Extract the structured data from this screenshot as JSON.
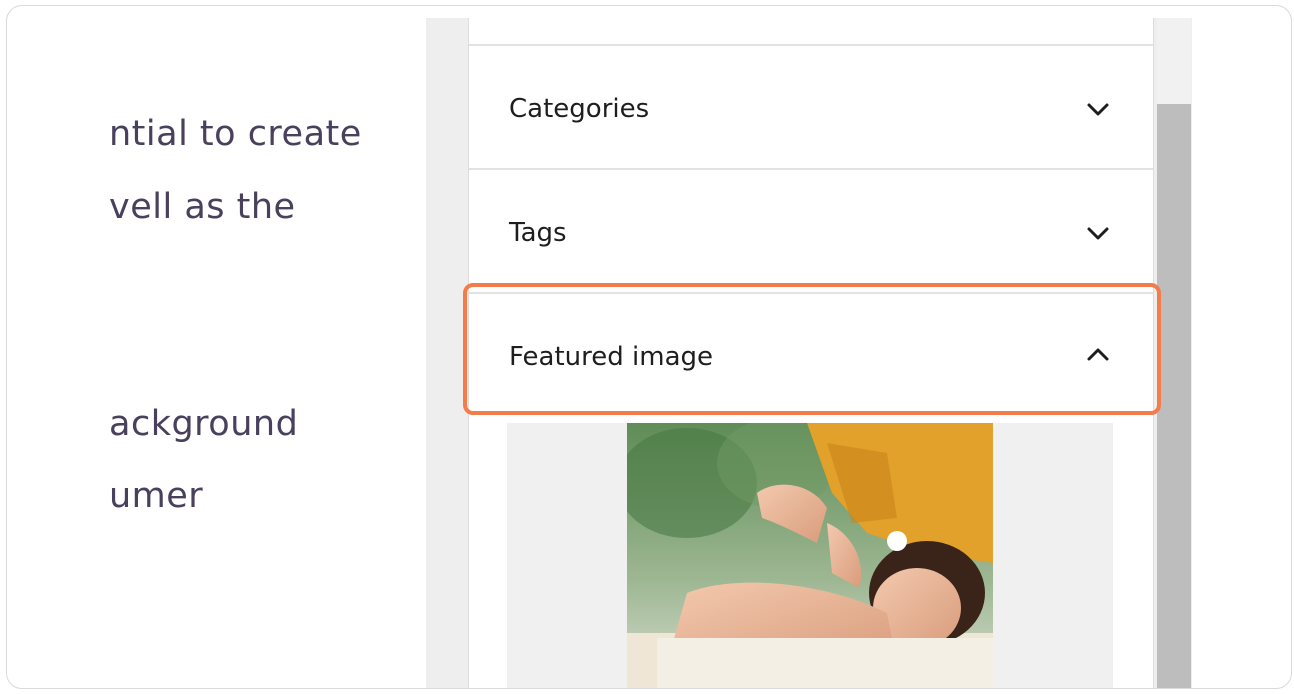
{
  "editor": {
    "lines": [
      "ntial to create",
      "vell as the",
      "ackground",
      "umer"
    ]
  },
  "sidebar": {
    "sections": [
      {
        "label": "Categories",
        "state": "collapsed",
        "icon": "chevron-down-icon"
      },
      {
        "label": "Tags",
        "state": "collapsed",
        "icon": "chevron-down-icon"
      },
      {
        "label": "Featured image",
        "state": "expanded",
        "icon": "chevron-up-icon"
      }
    ]
  },
  "colors": {
    "highlight": "#f47c4a",
    "editor_text": "#48405c"
  }
}
